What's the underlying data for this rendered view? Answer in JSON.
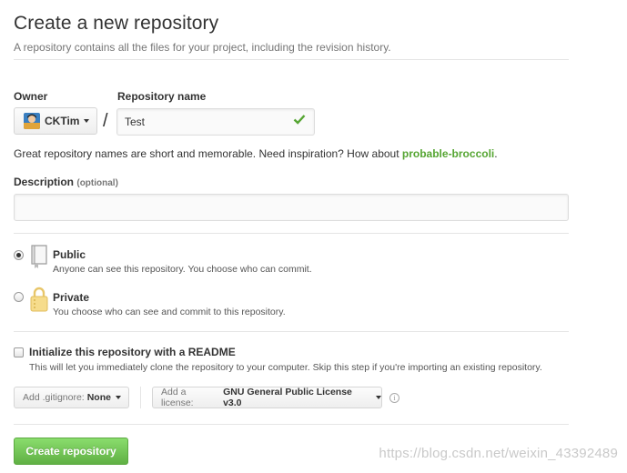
{
  "header": {
    "title": "Create a new repository",
    "subtitle": "A repository contains all the files for your project, including the revision history."
  },
  "owner": {
    "label": "Owner",
    "value": "CKTim"
  },
  "repo": {
    "label": "Repository name",
    "value": "Test",
    "separator": "/"
  },
  "hint": {
    "prefix": "Great repository names are short and memorable. Need inspiration? How about ",
    "suggestion": "probable-broccoli",
    "suffix": "."
  },
  "description": {
    "label": "Description",
    "optional": "(optional)",
    "value": ""
  },
  "visibility": {
    "public": {
      "title": "Public",
      "desc": "Anyone can see this repository. You choose who can commit.",
      "selected": true
    },
    "private": {
      "title": "Private",
      "desc": "You choose who can see and commit to this repository.",
      "selected": false
    }
  },
  "readme": {
    "title": "Initialize this repository with a README",
    "desc": "This will let you immediately clone the repository to your computer. Skip this step if you're importing an existing repository.",
    "checked": false
  },
  "gitignore": {
    "prefix": "Add .gitignore:",
    "value": "None"
  },
  "license": {
    "prefix": "Add a license:",
    "value": "GNU General Public License v3.0"
  },
  "info_glyph": "i",
  "submit": {
    "label": "Create repository"
  },
  "watermark": "https://blog.csdn.net/weixin_43392489",
  "colors": {
    "accent_green": "#55a532",
    "button_green": "#60b044",
    "divider": "#e5e5e5"
  }
}
